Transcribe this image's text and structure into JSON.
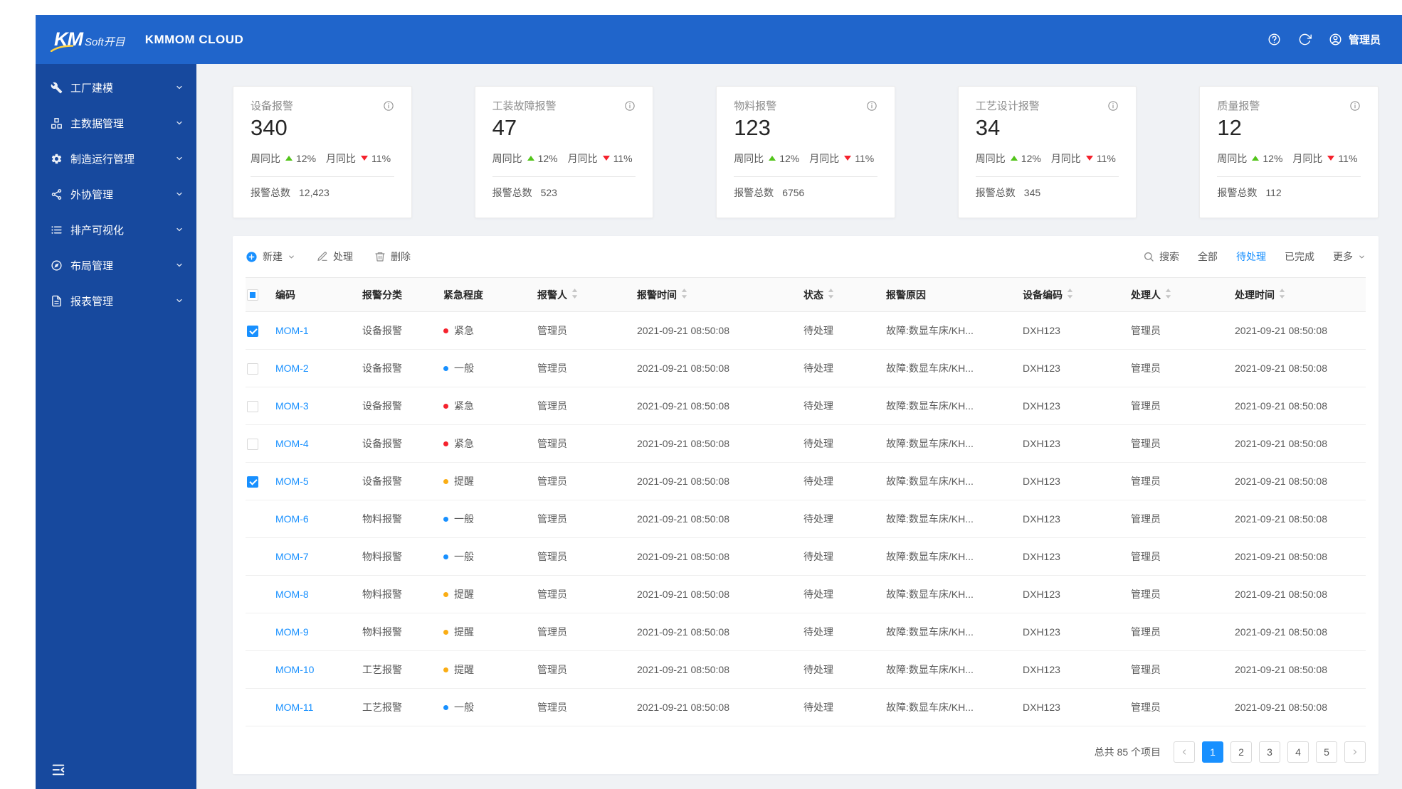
{
  "colors": {
    "topbar_blue": "#2065cb",
    "sidebar_blue": "#17499e",
    "accent_blue": "#1890ff",
    "success_green": "#52c41a",
    "danger_red": "#f5222d",
    "warning_yellow": "#faad14"
  },
  "header": {
    "logo_mark": "KM",
    "logo_suffix": "Soft开目",
    "product_name": "KMMOM CLOUD",
    "user_name": "管理员"
  },
  "sidebar": {
    "items": [
      {
        "label": "工厂建模",
        "icon": "wrench-icon"
      },
      {
        "label": "主数据管理",
        "icon": "grid-icon"
      },
      {
        "label": "制造运行管理",
        "icon": "gear-icon"
      },
      {
        "label": "外协管理",
        "icon": "share-icon"
      },
      {
        "label": "排产可视化",
        "icon": "list-icon"
      },
      {
        "label": "布局管理",
        "icon": "compass-icon"
      },
      {
        "label": "报表管理",
        "icon": "document-icon"
      }
    ]
  },
  "cards": [
    {
      "title": "设备报警",
      "value": "340",
      "week_label": "周同比",
      "week_value": "12%",
      "month_label": "月同比",
      "month_value": "11%",
      "total_label": "报警总数",
      "total_value": "12,423"
    },
    {
      "title": "工装故障报警",
      "value": "47",
      "week_label": "周同比",
      "week_value": "12%",
      "month_label": "月同比",
      "month_value": "11%",
      "total_label": "报警总数",
      "total_value": "523"
    },
    {
      "title": "物料报警",
      "value": "123",
      "week_label": "周同比",
      "week_value": "12%",
      "month_label": "月同比",
      "month_value": "11%",
      "total_label": "报警总数",
      "total_value": "6756"
    },
    {
      "title": "工艺设计报警",
      "value": "34",
      "week_label": "周同比",
      "week_value": "12%",
      "month_label": "月同比",
      "month_value": "11%",
      "total_label": "报警总数",
      "total_value": "345"
    },
    {
      "title": "质量报警",
      "value": "12",
      "week_label": "周同比",
      "week_value": "12%",
      "month_label": "月同比",
      "month_value": "11%",
      "total_label": "报警总数",
      "total_value": "112"
    }
  ],
  "toolbar": {
    "new_label": "新建",
    "process_label": "处理",
    "delete_label": "删除",
    "search_label": "搜索",
    "filter_all": "全部",
    "filter_pending": "待处理",
    "filter_done": "已完成",
    "more_label": "更多"
  },
  "table": {
    "columns": [
      {
        "label": "编码",
        "sortable": false
      },
      {
        "label": "报警分类",
        "sortable": false
      },
      {
        "label": "紧急程度",
        "sortable": false
      },
      {
        "label": "报警人",
        "sortable": true
      },
      {
        "label": "报警时间",
        "sortable": true
      },
      {
        "label": "状态",
        "sortable": true
      },
      {
        "label": "报警原因",
        "sortable": false
      },
      {
        "label": "设备编码",
        "sortable": true
      },
      {
        "label": "处理人",
        "sortable": true
      },
      {
        "label": "处理时间",
        "sortable": true
      }
    ],
    "rows": [
      {
        "checkbox": "checked",
        "code": "MOM-1",
        "category": "设备报警",
        "urgency": "紧急",
        "urgency_level": "urgent",
        "reporter": "管理员",
        "report_time": "2021-09-21 08:50:08",
        "status": "待处理",
        "reason": "故障:数显车床/KH...",
        "device_code": "DXH123",
        "handler": "管理员",
        "handle_time": "2021-09-21 08:50:08"
      },
      {
        "checkbox": "unchecked",
        "code": "MOM-2",
        "category": "设备报警",
        "urgency": "一般",
        "urgency_level": "normal",
        "reporter": "管理员",
        "report_time": "2021-09-21 08:50:08",
        "status": "待处理",
        "reason": "故障:数显车床/KH...",
        "device_code": "DXH123",
        "handler": "管理员",
        "handle_time": "2021-09-21 08:50:08"
      },
      {
        "checkbox": "unchecked",
        "code": "MOM-3",
        "category": "设备报警",
        "urgency": "紧急",
        "urgency_level": "urgent",
        "reporter": "管理员",
        "report_time": "2021-09-21 08:50:08",
        "status": "待处理",
        "reason": "故障:数显车床/KH...",
        "device_code": "DXH123",
        "handler": "管理员",
        "handle_time": "2021-09-21 08:50:08"
      },
      {
        "checkbox": "unchecked",
        "code": "MOM-4",
        "category": "设备报警",
        "urgency": "紧急",
        "urgency_level": "urgent",
        "reporter": "管理员",
        "report_time": "2021-09-21 08:50:08",
        "status": "待处理",
        "reason": "故障:数显车床/KH...",
        "device_code": "DXH123",
        "handler": "管理员",
        "handle_time": "2021-09-21 08:50:08"
      },
      {
        "checkbox": "checked",
        "code": "MOM-5",
        "category": "设备报警",
        "urgency": "提醒",
        "urgency_level": "remind",
        "reporter": "管理员",
        "report_time": "2021-09-21 08:50:08",
        "status": "待处理",
        "reason": "故障:数显车床/KH...",
        "device_code": "DXH123",
        "handler": "管理员",
        "handle_time": "2021-09-21 08:50:08"
      },
      {
        "checkbox": "none",
        "code": "MOM-6",
        "category": "物料报警",
        "urgency": "一般",
        "urgency_level": "normal",
        "reporter": "管理员",
        "report_time": "2021-09-21 08:50:08",
        "status": "待处理",
        "reason": "故障:数显车床/KH...",
        "device_code": "DXH123",
        "handler": "管理员",
        "handle_time": "2021-09-21 08:50:08"
      },
      {
        "checkbox": "none",
        "code": "MOM-7",
        "category": "物料报警",
        "urgency": "一般",
        "urgency_level": "normal",
        "reporter": "管理员",
        "report_time": "2021-09-21 08:50:08",
        "status": "待处理",
        "reason": "故障:数显车床/KH...",
        "device_code": "DXH123",
        "handler": "管理员",
        "handle_time": "2021-09-21 08:50:08"
      },
      {
        "checkbox": "none",
        "code": "MOM-8",
        "category": "物料报警",
        "urgency": "提醒",
        "urgency_level": "remind",
        "reporter": "管理员",
        "report_time": "2021-09-21 08:50:08",
        "status": "待处理",
        "reason": "故障:数显车床/KH...",
        "device_code": "DXH123",
        "handler": "管理员",
        "handle_time": "2021-09-21 08:50:08"
      },
      {
        "checkbox": "none",
        "code": "MOM-9",
        "category": "物料报警",
        "urgency": "提醒",
        "urgency_level": "remind",
        "reporter": "管理员",
        "report_time": "2021-09-21 08:50:08",
        "status": "待处理",
        "reason": "故障:数显车床/KH...",
        "device_code": "DXH123",
        "handler": "管理员",
        "handle_time": "2021-09-21 08:50:08"
      },
      {
        "checkbox": "none",
        "code": "MOM-10",
        "category": "工艺报警",
        "urgency": "提醒",
        "urgency_level": "remind",
        "reporter": "管理员",
        "report_time": "2021-09-21 08:50:08",
        "status": "待处理",
        "reason": "故障:数显车床/KH...",
        "device_code": "DXH123",
        "handler": "管理员",
        "handle_time": "2021-09-21 08:50:08"
      },
      {
        "checkbox": "none",
        "code": "MOM-11",
        "category": "工艺报警",
        "urgency": "一般",
        "urgency_level": "normal",
        "reporter": "管理员",
        "report_time": "2021-09-21 08:50:08",
        "status": "待处理",
        "reason": "故障:数显车床/KH...",
        "device_code": "DXH123",
        "handler": "管理员",
        "handle_time": "2021-09-21 08:50:08"
      }
    ]
  },
  "pagination": {
    "total_text": "总共 85 个项目",
    "pages": [
      "1",
      "2",
      "3",
      "4",
      "5"
    ],
    "active_page": "1"
  }
}
